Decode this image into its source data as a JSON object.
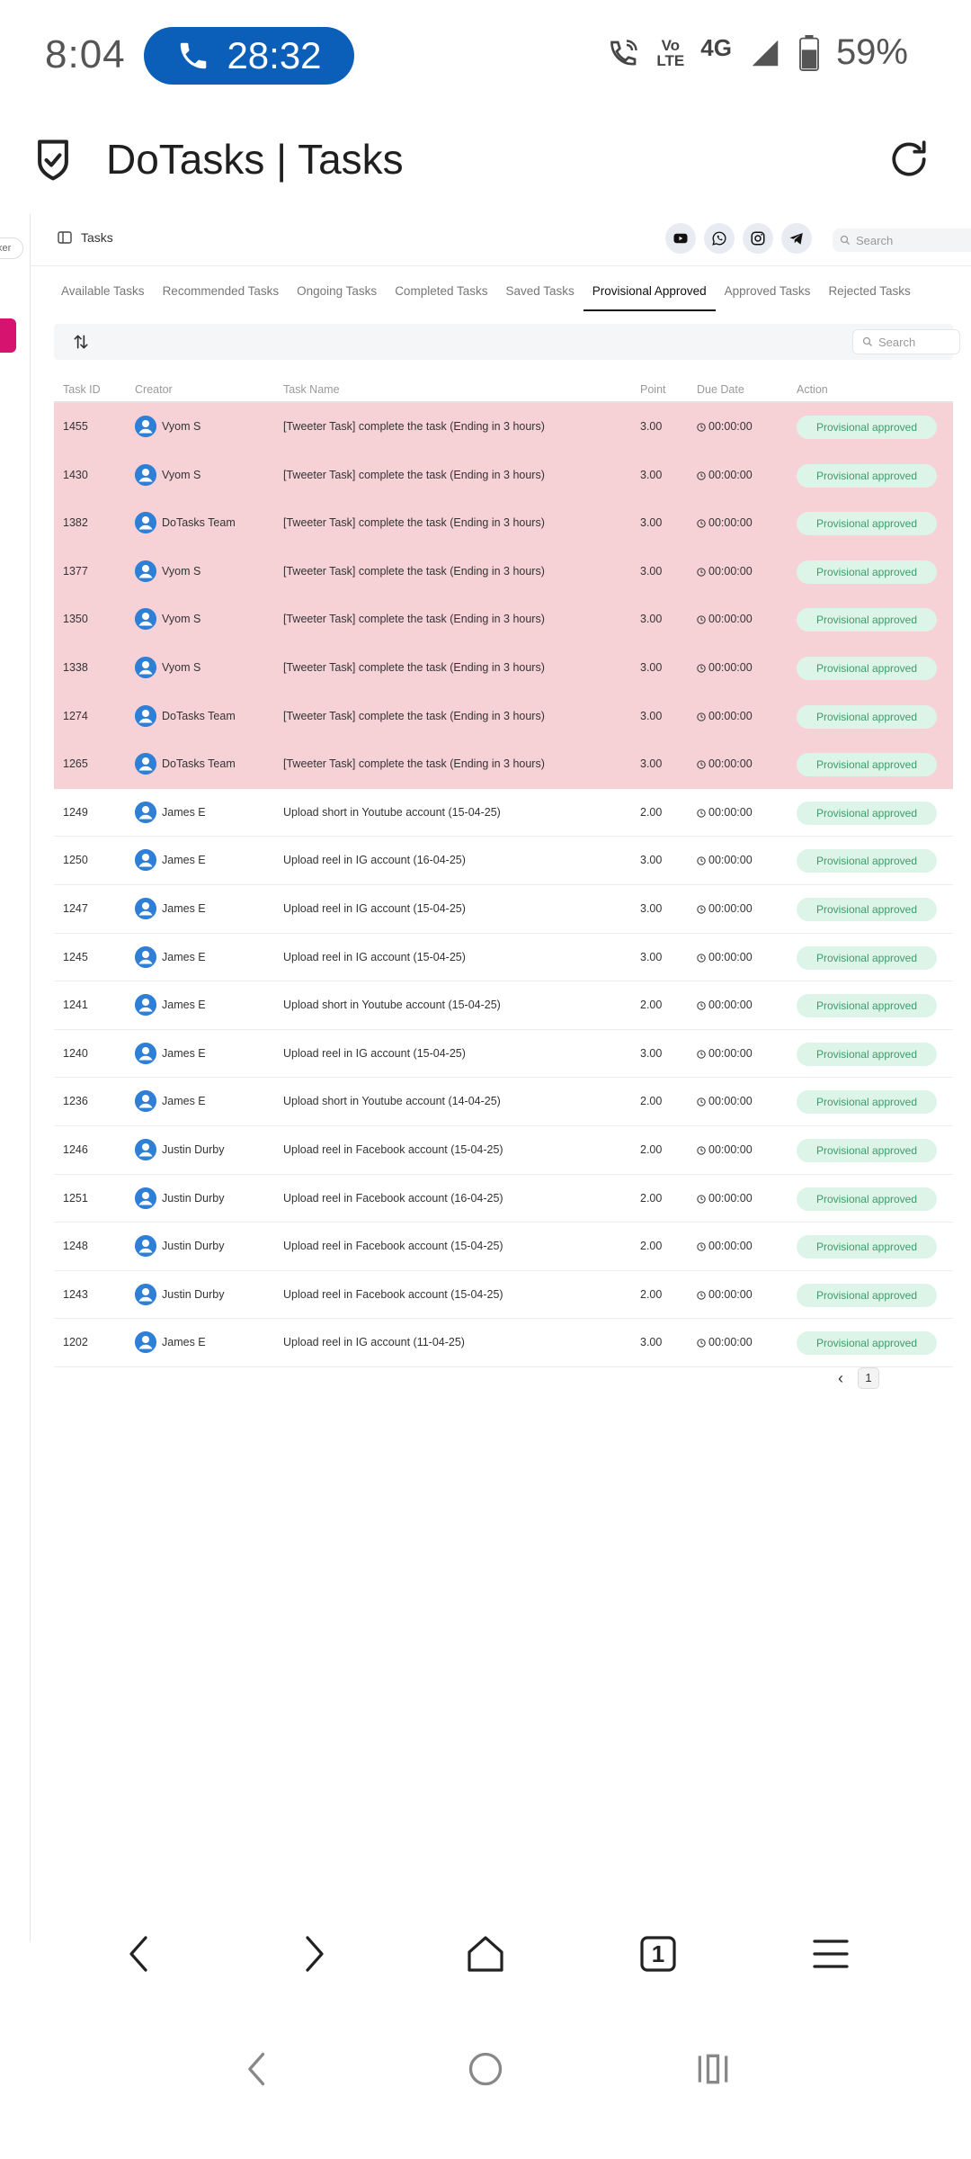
{
  "status": {
    "time": "8:04",
    "call_timer": "28:32",
    "volte_line1": "Vo",
    "volte_line2": "LTE",
    "network": "4G",
    "battery": "59%"
  },
  "app": {
    "title": "DoTasks | Tasks"
  },
  "side": {
    "chip_text": "ker"
  },
  "topbar": {
    "label": "Tasks",
    "search_placeholder": "Search"
  },
  "tabs": [
    {
      "label": "Available Tasks"
    },
    {
      "label": "Recommended Tasks"
    },
    {
      "label": "Ongoing Tasks"
    },
    {
      "label": "Completed Tasks"
    },
    {
      "label": "Saved Tasks"
    },
    {
      "label": "Provisional Approved"
    },
    {
      "label": "Approved Tasks"
    },
    {
      "label": "Rejected Tasks"
    }
  ],
  "active_tab_index": 5,
  "filter": {
    "search_placeholder": "Search"
  },
  "table": {
    "headers": {
      "id": "Task ID",
      "creator": "Creator",
      "name": "Task Name",
      "point": "Point",
      "due": "Due Date",
      "action": "Action"
    },
    "rows": [
      {
        "id": "1455",
        "creator": "Vyom S",
        "name": "[Tweeter Task] complete the task (Ending in 3 hours)",
        "point": "3.00",
        "due": "00:00:00",
        "action": "Provisional approved",
        "highlight": true
      },
      {
        "id": "1430",
        "creator": "Vyom S",
        "name": "[Tweeter Task] complete the task (Ending in 3 hours)",
        "point": "3.00",
        "due": "00:00:00",
        "action": "Provisional approved",
        "highlight": true
      },
      {
        "id": "1382",
        "creator": "DoTasks Team",
        "name": "[Tweeter Task] complete the task (Ending in 3 hours)",
        "point": "3.00",
        "due": "00:00:00",
        "action": "Provisional approved",
        "highlight": true
      },
      {
        "id": "1377",
        "creator": "Vyom S",
        "name": "[Tweeter Task] complete the task (Ending in 3 hours)",
        "point": "3.00",
        "due": "00:00:00",
        "action": "Provisional approved",
        "highlight": true
      },
      {
        "id": "1350",
        "creator": "Vyom S",
        "name": "[Tweeter Task] complete the task (Ending in 3 hours)",
        "point": "3.00",
        "due": "00:00:00",
        "action": "Provisional approved",
        "highlight": true
      },
      {
        "id": "1338",
        "creator": "Vyom S",
        "name": "[Tweeter Task] complete the task (Ending in 3 hours)",
        "point": "3.00",
        "due": "00:00:00",
        "action": "Provisional approved",
        "highlight": true
      },
      {
        "id": "1274",
        "creator": "DoTasks Team",
        "name": "[Tweeter Task] complete the task (Ending in 3 hours)",
        "point": "3.00",
        "due": "00:00:00",
        "action": "Provisional approved",
        "highlight": true
      },
      {
        "id": "1265",
        "creator": "DoTasks Team",
        "name": "[Tweeter Task] complete the task (Ending in 3 hours)",
        "point": "3.00",
        "due": "00:00:00",
        "action": "Provisional approved",
        "highlight": true
      },
      {
        "id": "1249",
        "creator": "James E",
        "name": "Upload short in Youtube account (15-04-25)",
        "point": "2.00",
        "due": "00:00:00",
        "action": "Provisional approved",
        "highlight": false
      },
      {
        "id": "1250",
        "creator": "James E",
        "name": "Upload reel in IG account (16-04-25)",
        "point": "3.00",
        "due": "00:00:00",
        "action": "Provisional approved",
        "highlight": false
      },
      {
        "id": "1247",
        "creator": "James E",
        "name": "Upload reel in IG account (15-04-25)",
        "point": "3.00",
        "due": "00:00:00",
        "action": "Provisional approved",
        "highlight": false
      },
      {
        "id": "1245",
        "creator": "James E",
        "name": "Upload reel in IG account (15-04-25)",
        "point": "3.00",
        "due": "00:00:00",
        "action": "Provisional approved",
        "highlight": false
      },
      {
        "id": "1241",
        "creator": "James E",
        "name": "Upload short in Youtube account (15-04-25)",
        "point": "2.00",
        "due": "00:00:00",
        "action": "Provisional approved",
        "highlight": false
      },
      {
        "id": "1240",
        "creator": "James E",
        "name": "Upload reel in IG account (15-04-25)",
        "point": "3.00",
        "due": "00:00:00",
        "action": "Provisional approved",
        "highlight": false
      },
      {
        "id": "1236",
        "creator": "James E",
        "name": "Upload short in Youtube account (14-04-25)",
        "point": "2.00",
        "due": "00:00:00",
        "action": "Provisional approved",
        "highlight": false
      },
      {
        "id": "1246",
        "creator": "Justin Durby",
        "name": "Upload reel in Facebook account (15-04-25)",
        "point": "2.00",
        "due": "00:00:00",
        "action": "Provisional approved",
        "highlight": false
      },
      {
        "id": "1251",
        "creator": "Justin Durby",
        "name": "Upload reel in Facebook account (16-04-25)",
        "point": "2.00",
        "due": "00:00:00",
        "action": "Provisional approved",
        "highlight": false
      },
      {
        "id": "1248",
        "creator": "Justin Durby",
        "name": "Upload reel in Facebook account (15-04-25)",
        "point": "2.00",
        "due": "00:00:00",
        "action": "Provisional approved",
        "highlight": false
      },
      {
        "id": "1243",
        "creator": "Justin Durby",
        "name": "Upload reel in Facebook account (15-04-25)",
        "point": "2.00",
        "due": "00:00:00",
        "action": "Provisional approved",
        "highlight": false
      },
      {
        "id": "1202",
        "creator": "James E",
        "name": "Upload reel in IG account (11-04-25)",
        "point": "3.00",
        "due": "00:00:00",
        "action": "Provisional approved",
        "highlight": false
      }
    ]
  },
  "pagination": {
    "prev": "‹",
    "current_page": "1"
  },
  "browser": {
    "tab_count": "1"
  },
  "colors": {
    "highlight_row": "#f6d2d6",
    "badge_bg": "#dcf5e8",
    "badge_text": "#3c9d69",
    "call_pill": "#0b5fb8",
    "accent_pink": "#d6146f"
  },
  "icons": [
    "phone-icon",
    "wifi-call-icon",
    "signal-icon",
    "battery-icon",
    "shield-check-icon",
    "reload-icon",
    "sidebar-toggle-icon",
    "youtube-icon",
    "whatsapp-icon",
    "instagram-icon",
    "telegram-icon",
    "search-icon",
    "sort-icon",
    "user-avatar-icon",
    "clock-icon",
    "back-icon",
    "forward-icon",
    "home-icon",
    "tabs-icon",
    "menu-icon"
  ]
}
